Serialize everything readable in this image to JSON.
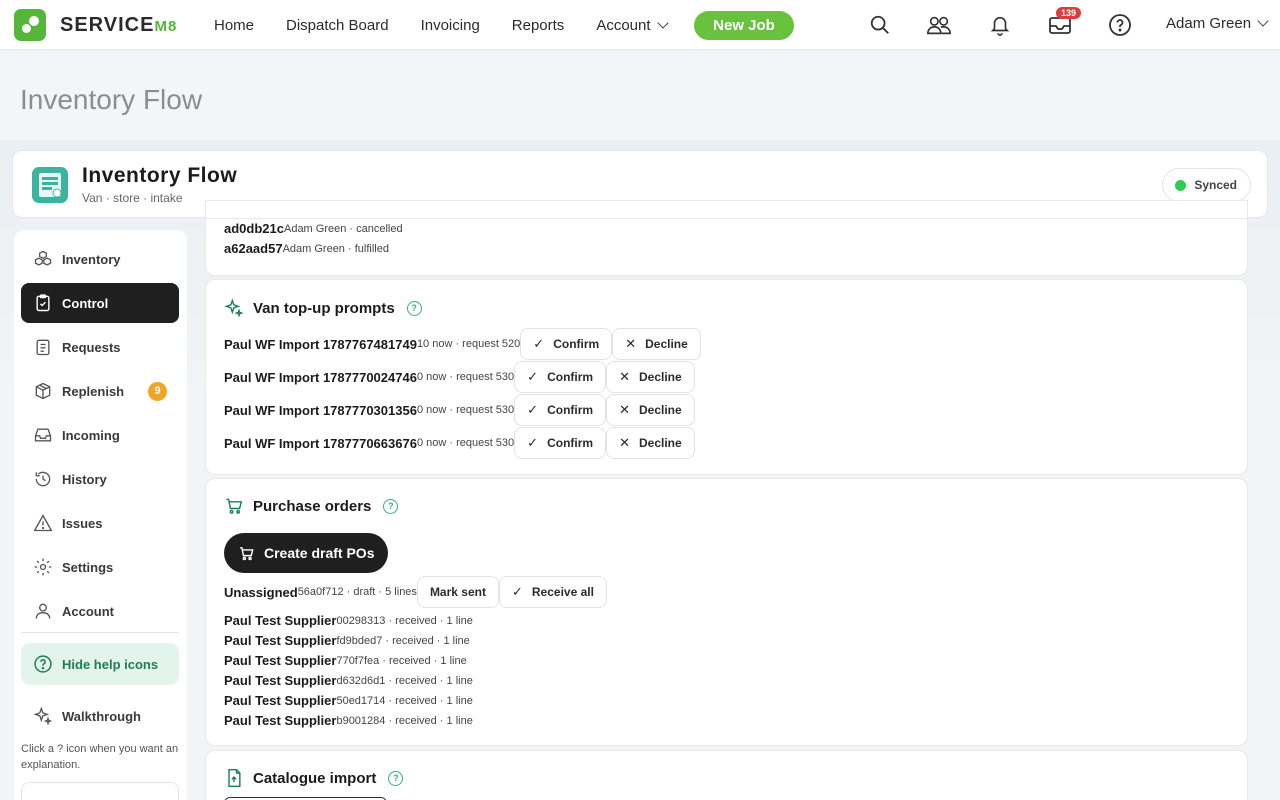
{
  "nav": {
    "brand": "SERVICEM8",
    "links": [
      "Home",
      "Dispatch Board",
      "Invoicing",
      "Reports",
      "Account"
    ],
    "new_job": "New Job",
    "inbox_count": "139",
    "user": "Adam Green"
  },
  "page_title": "Inventory Flow",
  "app": {
    "name": "Inventory Flow",
    "subtitle": "Van · store · intake",
    "sync_status": "Synced"
  },
  "sidebar": {
    "items": [
      {
        "label": "Inventory",
        "icon": "boxes-icon"
      },
      {
        "label": "Control",
        "icon": "clipboard-check-icon"
      },
      {
        "label": "Requests",
        "icon": "list-icon"
      },
      {
        "label": "Replenish",
        "icon": "package-icon",
        "count": "9"
      },
      {
        "label": "Incoming",
        "icon": "inbox-icon"
      },
      {
        "label": "History",
        "icon": "history-icon"
      },
      {
        "label": "Issues",
        "icon": "warning-icon"
      },
      {
        "label": "Settings",
        "icon": "gear-icon"
      },
      {
        "label": "Account",
        "icon": "user-icon"
      }
    ],
    "help_toggle": "Hide help icons",
    "walkthrough": "Walkthrough",
    "hint": "Click a ? icon when you want an explanation."
  },
  "orders_tail": [
    {
      "id": "ad0db21c",
      "meta": "Adam Green · cancelled"
    },
    {
      "id": "a62aad57",
      "meta": "Adam Green · fulfilled"
    }
  ],
  "topup": {
    "title": "Van top-up prompts",
    "confirm": "Confirm",
    "decline": "Decline",
    "rows": [
      {
        "name": "Paul WF Import 1787767481749",
        "meta": "10 now · request 520"
      },
      {
        "name": "Paul WF Import 1787770024746",
        "meta": "0 now · request 530"
      },
      {
        "name": "Paul WF Import 1787770301356",
        "meta": "0 now · request 530"
      },
      {
        "name": "Paul WF Import 1787770663676",
        "meta": "0 now · request 530"
      }
    ]
  },
  "po": {
    "title": "Purchase orders",
    "create": "Create draft POs",
    "first": {
      "name": "Unassigned",
      "meta": "56a0f712 · draft · 5 lines",
      "mark_sent": "Mark sent",
      "receive_all": "Receive all"
    },
    "rows": [
      {
        "name": "Paul Test Supplier",
        "meta": "00298313 · received · 1 line"
      },
      {
        "name": "Paul Test Supplier",
        "meta": "fd9bded7 · received · 1 line"
      },
      {
        "name": "Paul Test Supplier",
        "meta": "770f7fea · received · 1 line"
      },
      {
        "name": "Paul Test Supplier",
        "meta": "d632d6d1 · received · 1 line"
      },
      {
        "name": "Paul Test Supplier",
        "meta": "50ed1714 · received · 1 line"
      },
      {
        "name": "Paul Test Supplier",
        "meta": "b9001284 · received · 1 line"
      }
    ]
  },
  "catalogue": {
    "title": "Catalogue import"
  }
}
